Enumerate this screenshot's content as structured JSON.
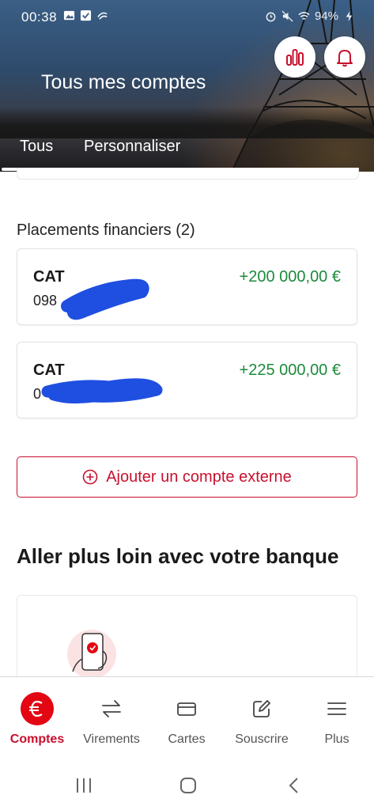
{
  "status_bar": {
    "time": "00:38",
    "right_text": "94%"
  },
  "header": {
    "title": "Tous mes comptes",
    "tabs": [
      {
        "label": "Tous",
        "active": true
      },
      {
        "label": "Personnaliser",
        "active": false
      }
    ]
  },
  "section": {
    "title": "Placements financiers (2)",
    "accounts": [
      {
        "name": "CAT",
        "number_visible": "098",
        "amount": "+200 000,00 €"
      },
      {
        "name": "CAT",
        "number_visible": "0",
        "amount": "+225 000,00 €"
      }
    ]
  },
  "add_external": {
    "label": "Ajouter un compte externe"
  },
  "promo": {
    "title": "Aller plus loin avec votre banque"
  },
  "bottom_nav": {
    "items": [
      {
        "label": "Comptes",
        "icon": "euro-icon",
        "active": true
      },
      {
        "label": "Virements",
        "icon": "transfer-arrows-icon",
        "active": false
      },
      {
        "label": "Cartes",
        "icon": "card-icon",
        "active": false
      },
      {
        "label": "Souscrire",
        "icon": "edit-icon",
        "active": false
      },
      {
        "label": "Plus",
        "icon": "menu-icon",
        "active": false
      }
    ]
  },
  "colors": {
    "brand_red": "#e30613",
    "positive_green": "#1c8a3c",
    "redaction_blue": "#1f4fe0"
  }
}
